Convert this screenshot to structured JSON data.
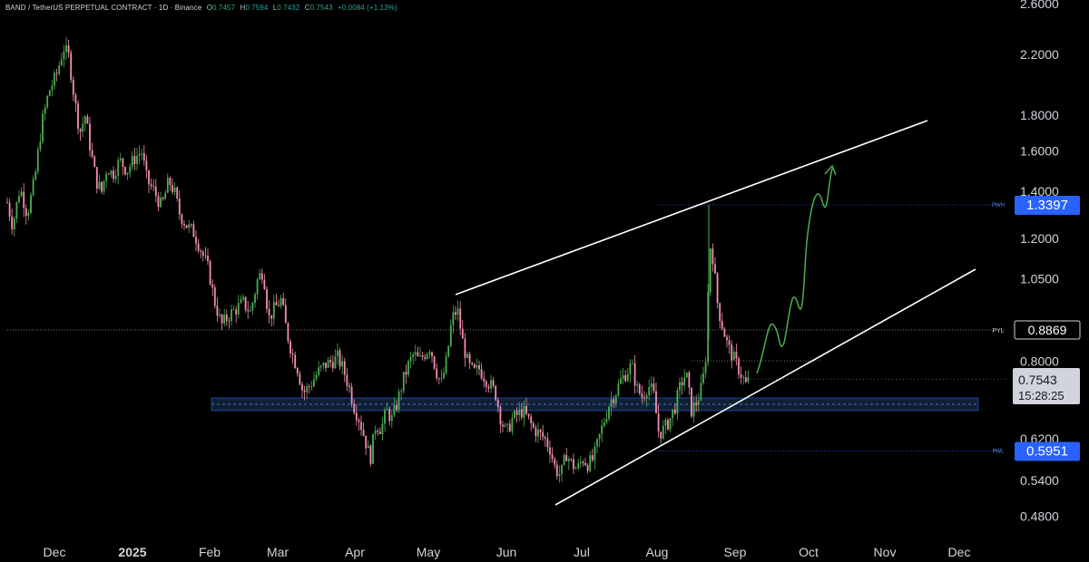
{
  "header": {
    "symbol_line": "BAND / TetherUS PERPETUAL CONTRACT · 1D · Binance",
    "o_label": "O",
    "o_value": "0.7457",
    "h_label": "H",
    "h_value": "0.7594",
    "l_label": "L",
    "l_value": "0.7432",
    "c_label": "C",
    "c_value": "0.7543",
    "change": "+0.0084 (+1.13%)"
  },
  "colors": {
    "background": "#000000",
    "up_candle": "#4caf50",
    "down_candle": "#f48fb1",
    "trendline": "#ffffff",
    "projection": "#4caf50",
    "support_zone": "#1e3a5f",
    "blue_level": "#2962ff",
    "price_label_bg": "#d1d4dc"
  },
  "chart_data": {
    "type": "candlestick",
    "scale": "log",
    "ylim": [
      0.45,
      2.65
    ],
    "y_ticks": [
      "2.6000",
      "2.2000",
      "1.8000",
      "1.6000",
      "1.4000",
      "1.2000",
      "1.0500",
      "0.8000",
      "0.6200",
      "0.5400",
      "0.4800"
    ],
    "x_ticks": [
      "Dec",
      "2025",
      "Feb",
      "Mar",
      "Apr",
      "May",
      "Jun",
      "Jul",
      "Aug",
      "Sep",
      "Oct",
      "Nov",
      "Dec"
    ],
    "price_labels": [
      {
        "key": "pwh",
        "tag": "PWH",
        "value": "1.3397",
        "style": "blue"
      },
      {
        "key": "pyl",
        "tag": "PYL",
        "value": "0.8869",
        "style": "dark"
      },
      {
        "key": "last",
        "tag": "",
        "value": "0.7543",
        "sub": "15:28:25",
        "style": "gray"
      },
      {
        "key": "pwl",
        "tag": "PWL",
        "value": "0.5951",
        "style": "blue"
      }
    ],
    "series": [
      {
        "x": [
          "Dec",
          "2025",
          "Feb",
          "Mar",
          "Apr",
          "May",
          "Jun",
          "Jul",
          "Aug",
          "Sep"
        ],
        "close": [
          2.2,
          1.45,
          0.95,
          0.78,
          0.64,
          0.98,
          0.65,
          0.56,
          0.76,
          0.7543
        ]
      }
    ],
    "annotations": [
      "Ascending channel (upper and lower trendlines)",
      "Support zone ~0.68–0.70",
      "Projected path to ~1.56"
    ]
  }
}
